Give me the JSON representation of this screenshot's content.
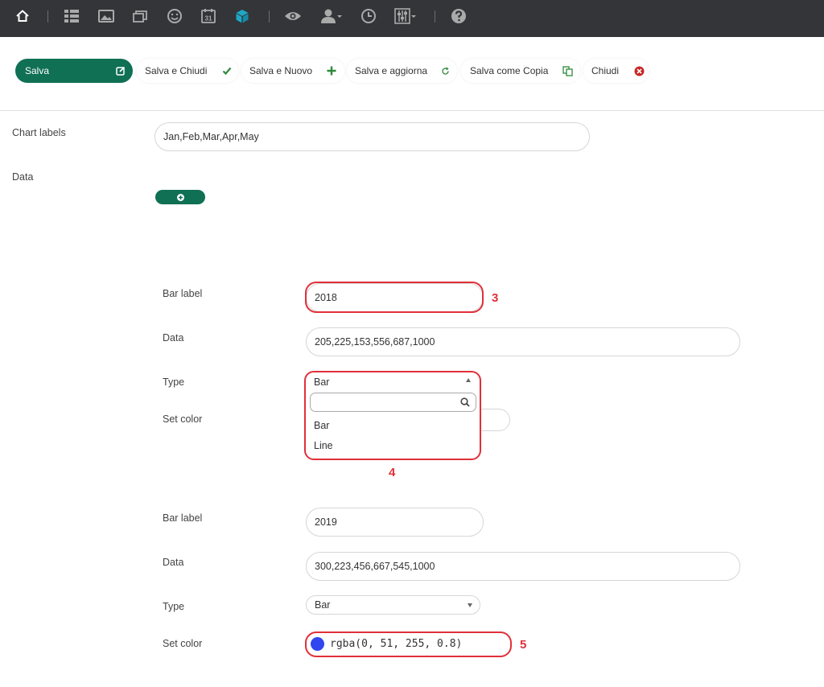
{
  "topbar": {
    "icons": [
      "home-icon",
      "list-icon",
      "image-icon",
      "gallery-icon",
      "smiley-icon",
      "calendar-icon",
      "cube-icon",
      "eye-icon",
      "user-icon",
      "clock-icon",
      "sliders-icon",
      "help-icon"
    ],
    "calendar_text": "31",
    "accent": "#1fa7c6"
  },
  "toolbar": {
    "save": "Salva",
    "save_close": "Salva e Chiudi",
    "save_new": "Salva e Nuovo",
    "save_refresh": "Salva e aggiorna",
    "save_copy": "Salva come Copia",
    "close": "Chiudi",
    "brand_color": "#107054"
  },
  "form": {
    "chart_labels_label": "Chart labels",
    "chart_labels_value": "Jan,Feb,Mar,Apr,May",
    "data_label": "Data"
  },
  "dataset1": {
    "bar_label_label": "Bar label",
    "bar_label_value": "2018",
    "data_label": "Data",
    "data_value": "205,225,153,556,687,1000",
    "type_label": "Type",
    "type_value": "Bar",
    "set_color_label": "Set color",
    "dropdown_options": [
      "Bar",
      "Line"
    ],
    "marker_bar_label": "3",
    "marker_dropdown": "4"
  },
  "dataset2": {
    "bar_label_label": "Bar label",
    "bar_label_value": "2019",
    "data_label": "Data",
    "data_value": "300,223,456,667,545,1000",
    "type_label": "Type",
    "type_value": "Bar",
    "set_color_label": "Set color",
    "color_value": "rgba(0, 51, 255, 0.8)",
    "marker_color": "5"
  },
  "colors": {
    "highlight": "#e0303a"
  }
}
